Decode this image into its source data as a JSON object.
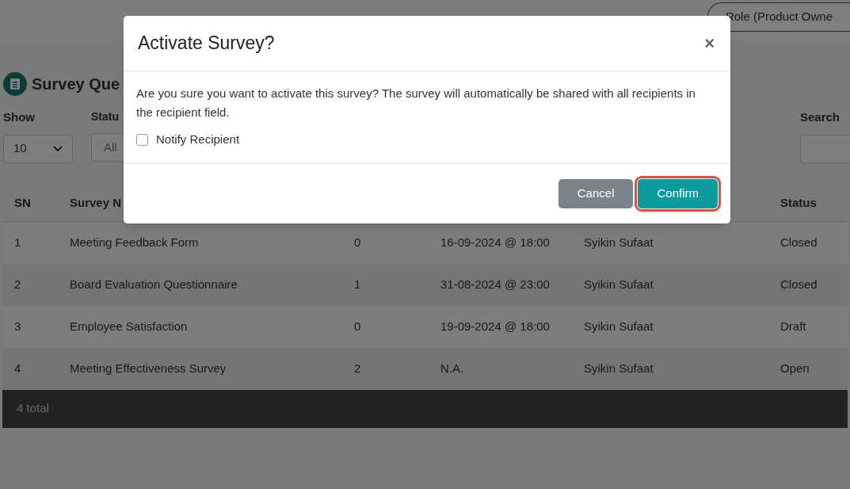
{
  "header": {
    "role_button": "Role (Product Owne"
  },
  "page": {
    "title": "Survey Que",
    "show_label": "Show",
    "show_value": "10",
    "status_label": "Statu",
    "status_value": "All",
    "search_label": "Search"
  },
  "table": {
    "columns": [
      "SN",
      "Survey N",
      "",
      "",
      "",
      "Status"
    ],
    "rows": [
      {
        "cells": [
          "1",
          "Meeting Feedback Form",
          "0",
          "16-09-2024 @ 18:00",
          "Syikin Sufaat",
          "Closed"
        ]
      },
      {
        "cells": [
          "2",
          "Board Evaluation Questionnaire",
          "1",
          "31-08-2024 @ 23:00",
          "Syikin Sufaat",
          "Closed"
        ]
      },
      {
        "cells": [
          "3",
          "Employee Satisfaction",
          "0",
          "19-09-2024 @ 18:00",
          "Syikin Sufaat",
          "Draft"
        ]
      },
      {
        "cells": [
          "4",
          "Meeting Effectiveness Survey",
          "2",
          "N.A.",
          "Syikin Sufaat",
          "Open"
        ]
      }
    ],
    "footer": "4 total"
  },
  "dialog": {
    "title": "Activate Survey?",
    "close": "×",
    "message": "Are you sure you want to activate this survey? The survey will automatically be shared with all recipients in the recipient field.",
    "checkbox": {
      "label": "Notify Recipient",
      "checked": false
    },
    "buttons": [
      {
        "label": "Cancel",
        "kind": "secondary",
        "focused": false
      },
      {
        "label": "Confirm",
        "kind": "primary",
        "focused": true
      }
    ]
  }
}
